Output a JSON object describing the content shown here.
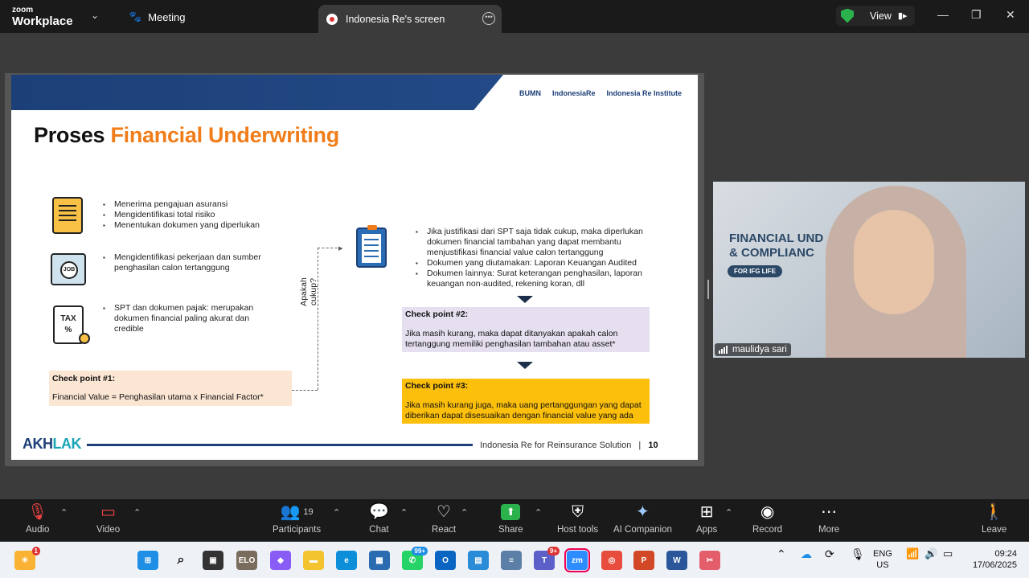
{
  "app": {
    "brand_top": "zoom",
    "brand_bottom": "Workplace"
  },
  "tabs": {
    "meeting": "Meeting",
    "screen": "Indonesia Re's screen"
  },
  "view_button": "View",
  "slide": {
    "title_black": "Proses",
    "title_orange": "Financial Underwriting",
    "logos": [
      "BUMN",
      "IndonesiaRe",
      "Indonesia Re Institute"
    ],
    "left_bullets_1": [
      "Menerima pengajuan asuransi",
      "Mengidentifikasi total risiko",
      "Menentukan dokumen yang diperlukan"
    ],
    "left_bullets_2": [
      "Mengidentifikasi pekerjaan dan sumber penghasilan calon tertanggung"
    ],
    "left_bullets_3": [
      "SPT dan dokumen pajak: merupakan dokumen financial paling akurat dan credible"
    ],
    "icon_job": "JOB",
    "icon_tax": "TAX",
    "vertical_label": "Apakah cukup?",
    "right_bullets": [
      "Jika justifikasi dari SPT saja tidak cukup, maka diperlukan dokumen financial tambahan yang dapat membantu menjustifikasi financial value calon tertanggung",
      "Dokumen yang diutamakan: Laporan Keuangan Audited",
      "Dokumen lainnya: Surat keterangan penghasilan, laporan keuangan non-audited, rekening koran, dll"
    ],
    "cp1_title": "Check point #1:",
    "cp1_text": "Financial Value = Penghasilan utama x Financial Factor*",
    "cp2_title": "Check point #2:",
    "cp2_text": "Jika masih kurang, maka dapat ditanyakan apakah calon tertanggung memiliki penghasilan tambahan atau asset*",
    "cp3_title": "Check point #3:",
    "cp3_text": "Jika masih kurang juga, maka uang pertanggungan yang dapat diberikan dapat disesuaikan dengan financial value yang ada",
    "footer_brand_a": "AKH",
    "footer_brand_b": "LAK",
    "footer_text": "Indonesia Re for Reinsurance Solution",
    "page_number": "10"
  },
  "video": {
    "participant_name": "maulidya sari",
    "bg_text_line1": "FINANCIAL UND",
    "bg_text_line2": "& COMPLIANC",
    "bg_pill": "FOR IFG LIFE"
  },
  "toolbar": {
    "audio": "Audio",
    "video": "Video",
    "participants": "Participants",
    "participants_count": "19",
    "chat": "Chat",
    "react": "React",
    "share": "Share",
    "host_tools": "Host tools",
    "ai_companion": "AI Companion",
    "apps": "Apps",
    "record": "Record",
    "more": "More",
    "leave": "Leave"
  },
  "taskbar": {
    "weather_badge": "1",
    "whatsapp_badge": "99+",
    "teams_badge": "9+",
    "lang_top": "ENG",
    "lang_bottom": "US",
    "time": "09:24",
    "date": "17/06/2025"
  },
  "colors": {
    "accent_orange": "#f07d1a",
    "navy": "#1c3f77",
    "share_green": "#2bb24c",
    "cp3_yellow": "#fbbf0c"
  }
}
